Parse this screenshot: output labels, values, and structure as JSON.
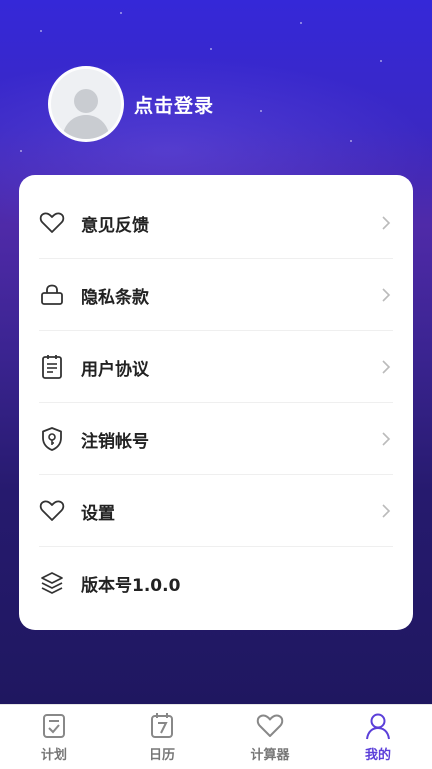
{
  "profile": {
    "login_label": "点击登录"
  },
  "menu": {
    "items": [
      {
        "label": "意见反馈",
        "icon": "heart-icon"
      },
      {
        "label": "隐私条款",
        "icon": "lock-icon"
      },
      {
        "label": "用户协议",
        "icon": "document-icon"
      },
      {
        "label": "注销帐号",
        "icon": "shield-key-icon"
      },
      {
        "label": "设置",
        "icon": "heart-icon"
      },
      {
        "label": "版本号1.0.0",
        "icon": "layers-icon"
      }
    ]
  },
  "tabbar": {
    "tabs": [
      {
        "label": "计划",
        "icon": "checklist-icon"
      },
      {
        "label": "日历",
        "icon": "calendar-icon"
      },
      {
        "label": "计算器",
        "icon": "heart-icon"
      },
      {
        "label": "我的",
        "icon": "user-icon"
      }
    ],
    "active_index": 3
  },
  "colors": {
    "accent": "#5b3fd9",
    "background_top": "#3528d8",
    "background_bottom": "#1f1760"
  }
}
